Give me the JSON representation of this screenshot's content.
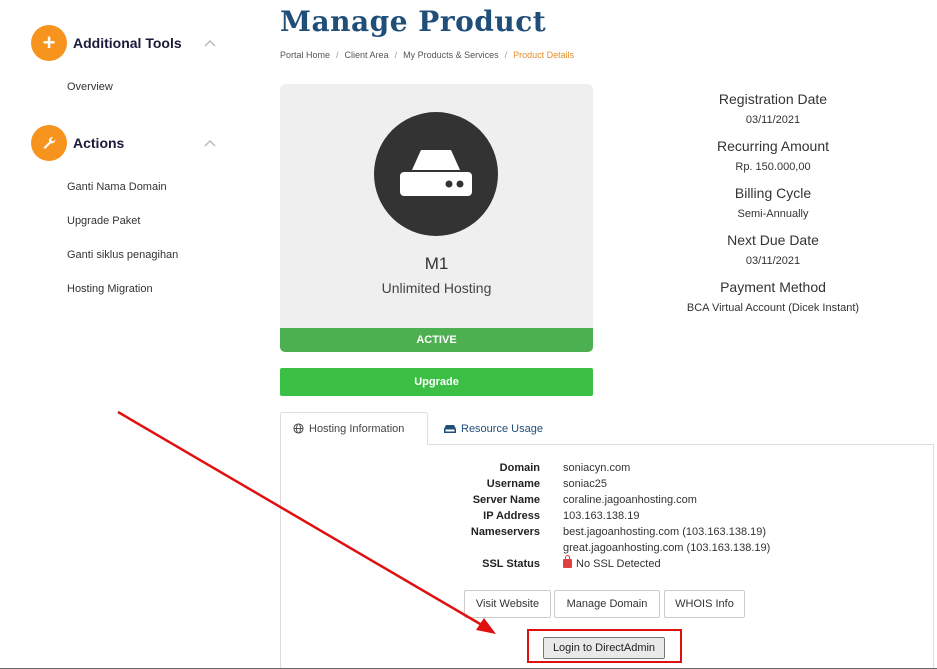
{
  "sidebar": {
    "tools": {
      "title": "Additional Tools",
      "items": [
        "Overview"
      ]
    },
    "actions": {
      "title": "Actions",
      "items": [
        "Ganti Nama Domain",
        "Upgrade Paket",
        "Ganti siklus penagihan",
        "Hosting Migration"
      ]
    }
  },
  "page": {
    "title": "Manage Product",
    "breadcrumb": [
      "Portal Home",
      "Client Area",
      "My Products & Services",
      "Product Details"
    ]
  },
  "product": {
    "name": "M1",
    "group": "Unlimited Hosting",
    "status": "ACTIVE",
    "upgrade_label": "Upgrade",
    "icon": "server-icon"
  },
  "details": {
    "registration_date_label": "Registration Date",
    "registration_date": "03/11/2021",
    "recurring_amount_label": "Recurring Amount",
    "recurring_amount": "Rp. 150.000,00",
    "billing_cycle_label": "Billing Cycle",
    "billing_cycle": "Semi-Annually",
    "next_due_label": "Next Due Date",
    "next_due": "03/11/2021",
    "payment_method_label": "Payment Method",
    "payment_method": "BCA Virtual Account (Dicek Instant)"
  },
  "tabs": {
    "hosting_info": "Hosting Information",
    "resource_usage": "Resource Usage"
  },
  "hosting": {
    "domain_label": "Domain",
    "domain": "soniacyn.com",
    "username_label": "Username",
    "username": "soniac25",
    "server_label": "Server Name",
    "server": "coraline.jagoanhosting.com",
    "ip_label": "IP Address",
    "ip": "103.163.138.19",
    "ns_label": "Nameservers",
    "ns1": "best.jagoanhosting.com (103.163.138.19)",
    "ns2": "great.jagoanhosting.com (103.163.138.19)",
    "ssl_label": "SSL Status",
    "ssl": "No SSL Detected"
  },
  "buttons": {
    "visit": "Visit Website",
    "manage_domain": "Manage Domain",
    "whois": "WHOIS Info",
    "login_da": "Login to DirectAdmin"
  },
  "colors": {
    "accent": "#f7941d",
    "status_green": "#4caf50",
    "upgrade_green": "#3cbf45",
    "title_blue": "#1f4e79",
    "annotation_red": "#e01010"
  }
}
